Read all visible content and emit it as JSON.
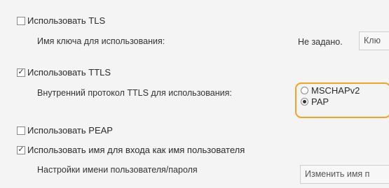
{
  "tls": {
    "checkbox_label": "Использовать TLS",
    "checked": false
  },
  "key_row": {
    "label": "Имя ключа для использования:",
    "value": "Не задано.",
    "button_label": "Клю"
  },
  "ttls": {
    "checkbox_label": "Использовать TTLS",
    "checked": true
  },
  "ttls_protocol": {
    "label": "Внутренний протокол TTLS для использования:",
    "options": [
      {
        "label": "MSCHAPv2",
        "selected": false
      },
      {
        "label": "PAP",
        "selected": true
      }
    ]
  },
  "peap": {
    "checkbox_label": "Использовать PEAP",
    "checked": false
  },
  "login_name": {
    "checkbox_label": "Использовать имя для входа как имя пользователя",
    "checked": true
  },
  "credentials_row": {
    "label": "Настройки имени пользователя/пароля",
    "button_label": "Изменить имя п"
  },
  "colors": {
    "highlight": "#f2a324"
  }
}
